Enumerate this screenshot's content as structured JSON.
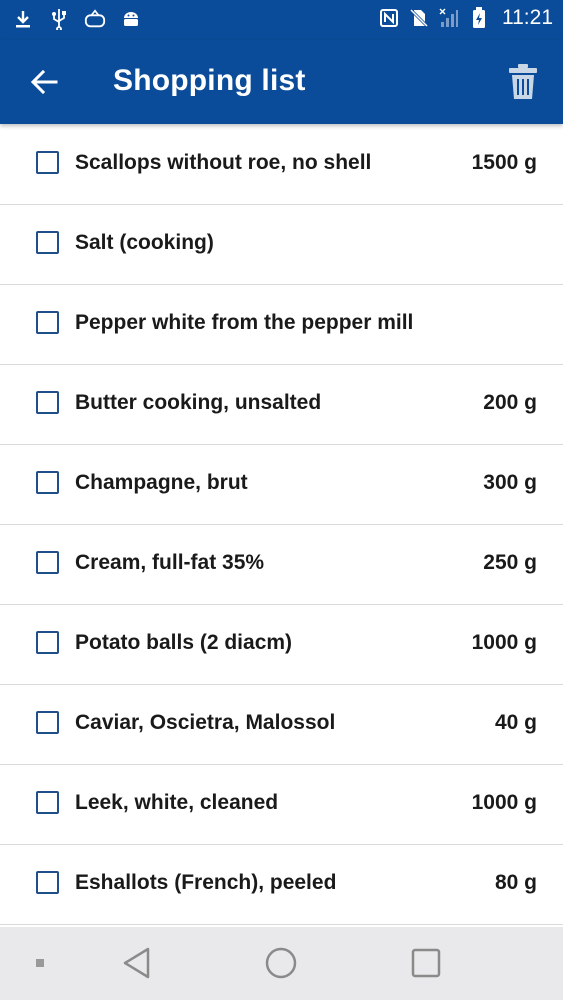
{
  "status_bar": {
    "time": "11:21",
    "left_icons": [
      "download-icon",
      "usb-icon",
      "sync-game-icon",
      "android-icon"
    ],
    "right_icons": [
      "nfc-icon",
      "no-sim-icon",
      "signal-icon",
      "battery-charging-icon"
    ]
  },
  "app_bar": {
    "title": "Shopping list",
    "back_icon": "arrow-back-icon",
    "delete_icon": "trash-icon"
  },
  "items": [
    {
      "name": "Scallops without roe, no shell",
      "qty": "1500 g",
      "checked": false
    },
    {
      "name": "Salt (cooking)",
      "qty": "",
      "checked": false
    },
    {
      "name": "Pepper white from the pepper mill",
      "qty": "",
      "checked": false
    },
    {
      "name": "Butter cooking, unsalted",
      "qty": "200 g",
      "checked": false
    },
    {
      "name": "Champagne, brut",
      "qty": "300 g",
      "checked": false
    },
    {
      "name": "Cream, full-fat 35%",
      "qty": "250 g",
      "checked": false
    },
    {
      "name": "Potato balls (2 diacm)",
      "qty": "1000 g",
      "checked": false
    },
    {
      "name": "Caviar, Oscietra, Malossol",
      "qty": "40 g",
      "checked": false
    },
    {
      "name": "Leek, white, cleaned",
      "qty": "1000 g",
      "checked": false
    },
    {
      "name": "Eshallots (French), peeled",
      "qty": "80 g",
      "checked": false
    }
  ],
  "nav_bar": {
    "buttons": [
      "menu-dot-icon",
      "back-triangle-icon",
      "home-circle-icon",
      "recents-square-icon"
    ]
  },
  "colors": {
    "primary": "#0b4c9a",
    "checkbox_border": "#1e4f8a",
    "divider": "#dadada",
    "nav_bg": "#e9e9eb"
  }
}
